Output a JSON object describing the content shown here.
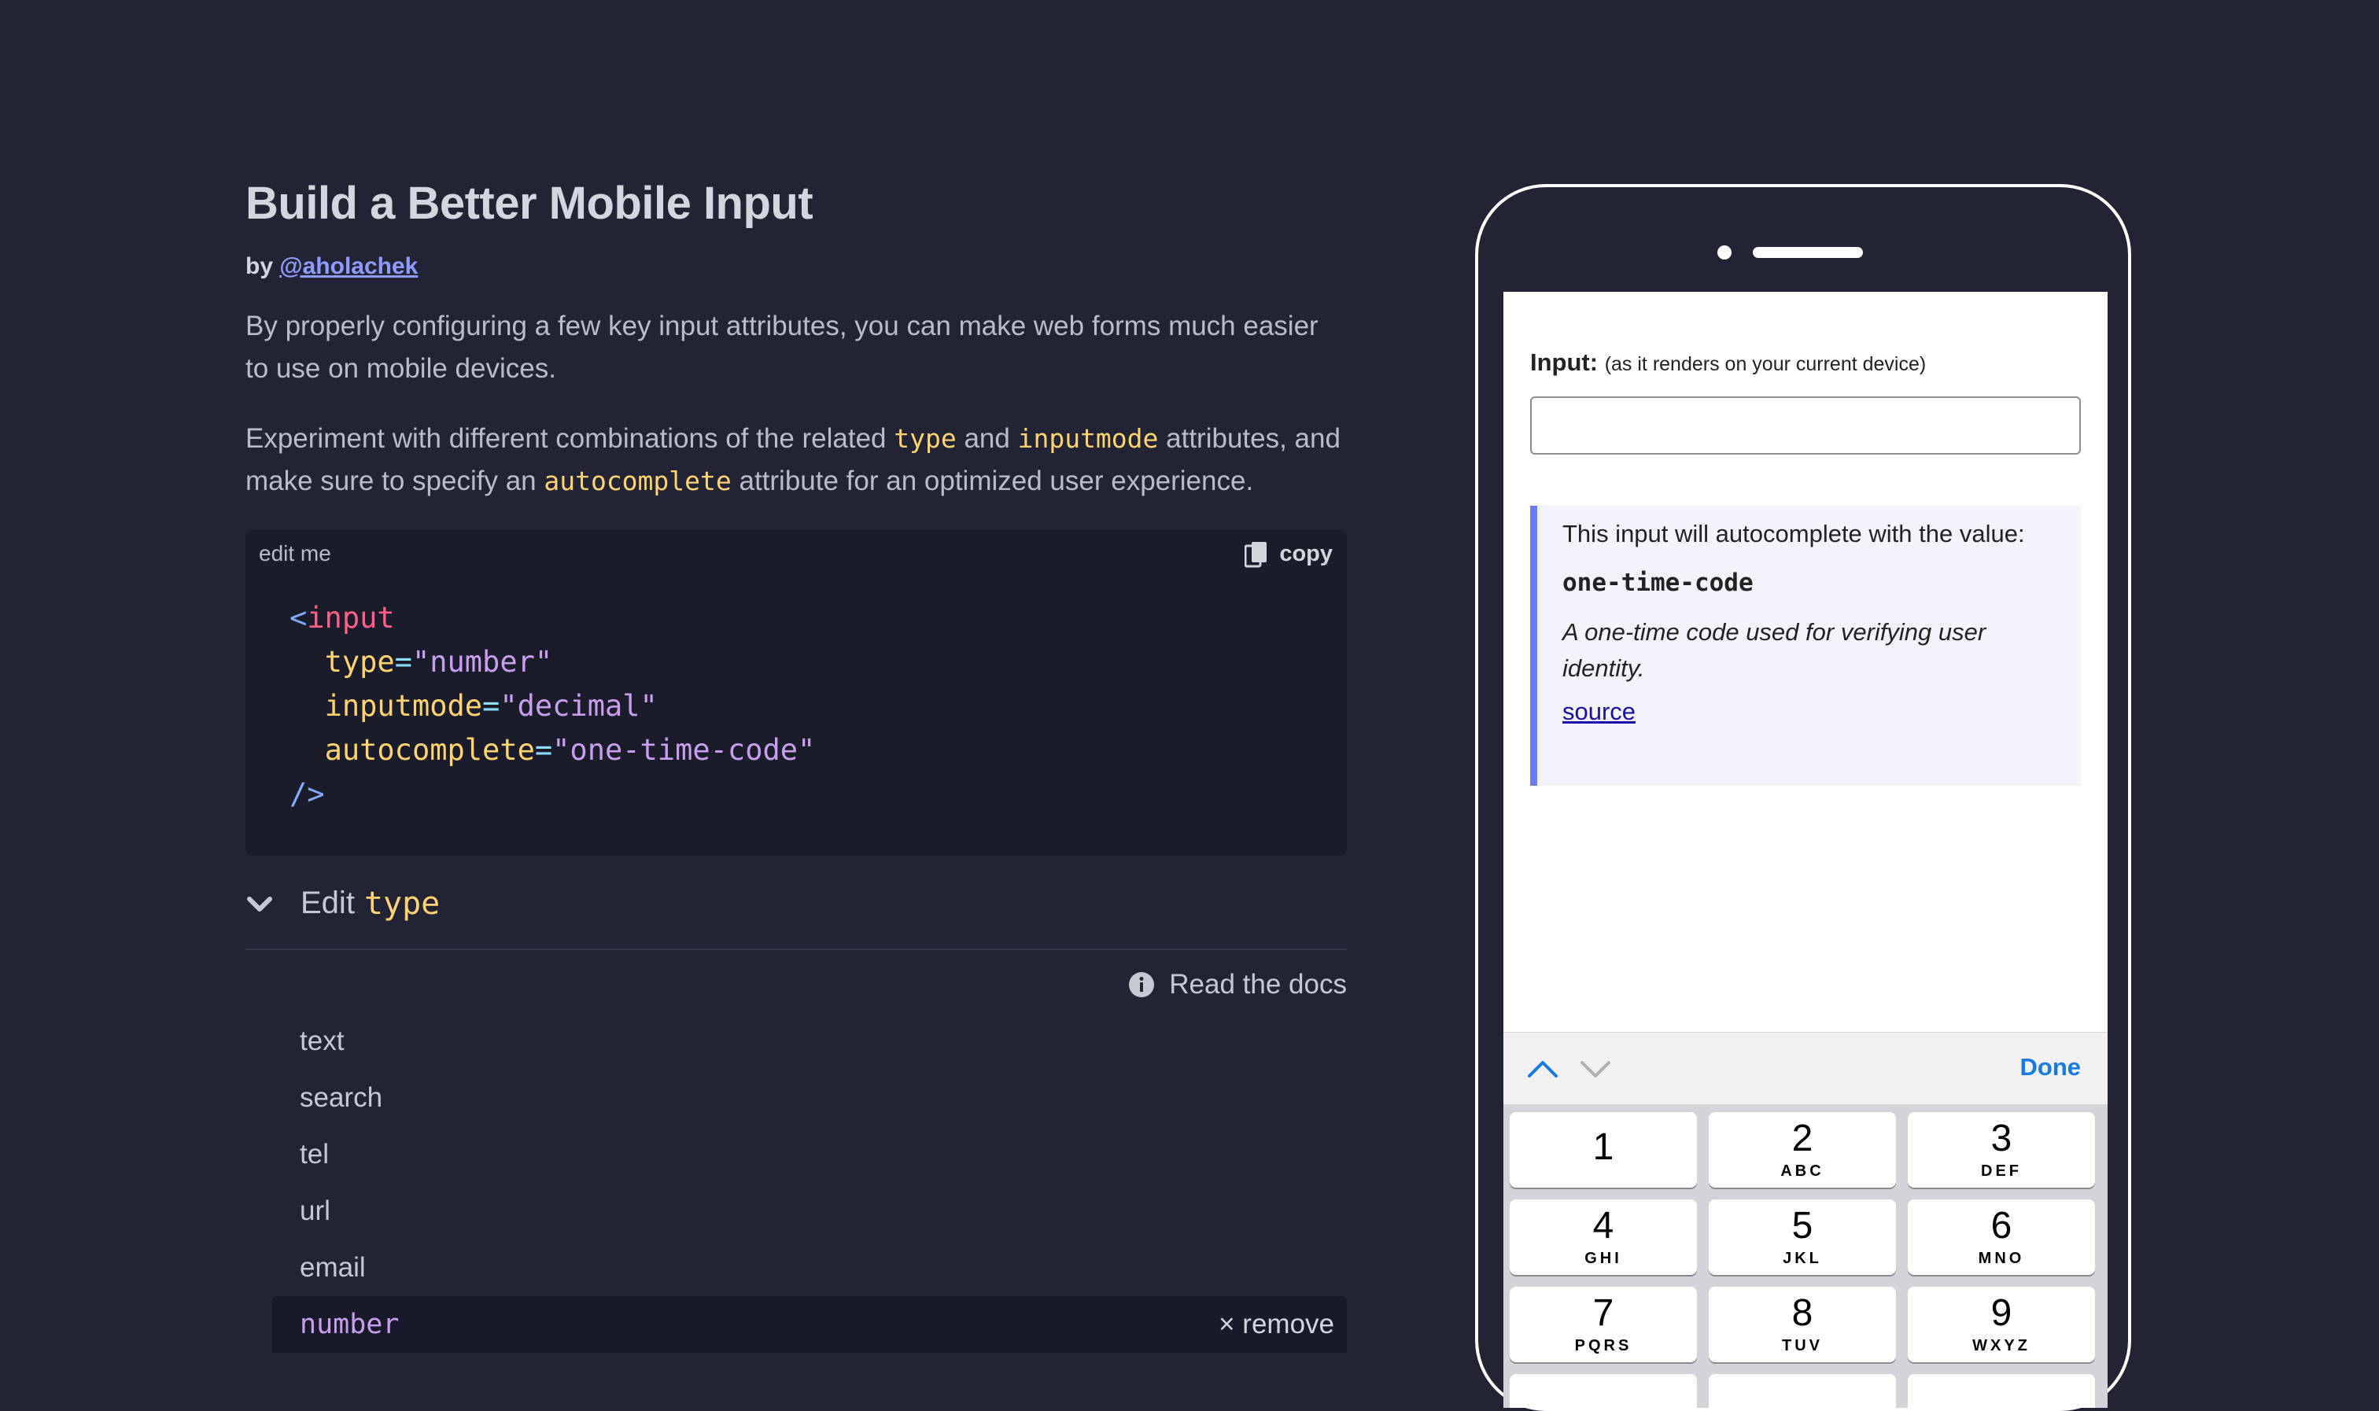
{
  "article": {
    "title": "Build a Better Mobile Input",
    "by": "by",
    "author": "@aholachek",
    "intro": "By properly configuring a few key input attributes, you can make web forms much easier to use on mobile devices.",
    "p2_a": "Experiment with different combinations of the related ",
    "p2_type": "type",
    "p2_b": " and ",
    "p2_inputmode": "inputmode",
    "p2_c": " attributes, and make sure to specify an ",
    "p2_autocomplete": "autocomplete",
    "p2_d": " attribute for an optimized user experience."
  },
  "editor": {
    "label": "edit me",
    "copy_label": "copy",
    "open": "<",
    "tag": "input",
    "attrs": [
      {
        "name": "type",
        "value": "\"number\""
      },
      {
        "name": "inputmode",
        "value": "\"decimal\""
      },
      {
        "name": "autocomplete",
        "value": "\"one-time-code\""
      }
    ],
    "equals": "=",
    "close": "/>"
  },
  "accordion": {
    "prefix": "Edit",
    "keyword": "type",
    "docs_label": "Read the docs",
    "options": [
      "text",
      "search",
      "tel",
      "url",
      "email"
    ],
    "selected": "number",
    "remove_label": "× remove"
  },
  "phone": {
    "input_label": "Input:",
    "input_note": "(as it renders on your current device)",
    "info_line": "This input will autocomplete with the value:",
    "info_value": "one-time-code",
    "info_desc": "A one-time code used for verifying user identity.",
    "info_link": "source",
    "done_label": "Done",
    "keys": [
      {
        "digit": "1",
        "letters": ""
      },
      {
        "digit": "2",
        "letters": "ABC"
      },
      {
        "digit": "3",
        "letters": "DEF"
      },
      {
        "digit": "4",
        "letters": "GHI"
      },
      {
        "digit": "5",
        "letters": "JKL"
      },
      {
        "digit": "6",
        "letters": "MNO"
      },
      {
        "digit": "7",
        "letters": "PQRS"
      },
      {
        "digit": "8",
        "letters": "TUV"
      },
      {
        "digit": "9",
        "letters": "WXYZ"
      }
    ]
  },
  "colors": {
    "background": "#222436",
    "accent": "#8f9cff",
    "keyword": "#ffd36e",
    "ios_blue": "#1579e6"
  },
  "icons": [
    "copy-icon",
    "chevron-down-icon",
    "info-icon",
    "chevron-up-icon",
    "close-icon"
  ]
}
